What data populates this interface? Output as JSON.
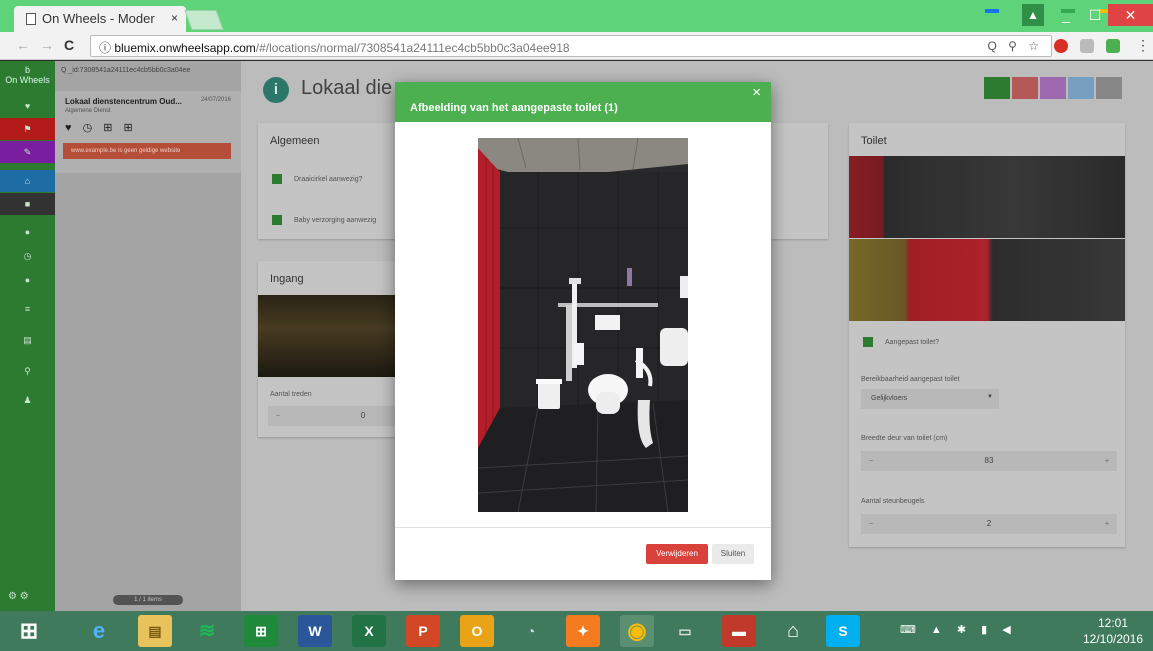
{
  "browser": {
    "tab_title": "On Wheels - Moder",
    "tab_close": "×",
    "window_controls": {
      "minimize": "_",
      "maximize": "☐",
      "close": "✕",
      "user": "▲"
    },
    "nav": {
      "back": "←",
      "forward": "→",
      "reload": "C"
    },
    "url_host": "bluemix.onwheelsapp.com",
    "url_path": "/#/locations/normal/7308541a24111ec4cb5bb0c3a04ee918",
    "url_right_icons": "Q ⚲ ☆",
    "menu": "⋮"
  },
  "rail": {
    "logo": "On Wheels",
    "items": [
      "♥",
      "⚑",
      "✎",
      "⌂",
      "■",
      "●",
      "◷",
      "●",
      "≡",
      "▤",
      "⚲",
      "♟"
    ],
    "bottom": "⚙ ⚙"
  },
  "list": {
    "search": "Q _id:7308541a24111ec4cb5bb0c3a04ee",
    "location_name": "Lokaal dienstencentrum Oud...",
    "location_date": "24/07/2016",
    "location_sub": "Algemene Dienst",
    "location_icons": "♥ ◷ ⊞ ⊞",
    "warning": "www.example.be is geen geldige website",
    "count": "1 / 1 items"
  },
  "main": {
    "info_icon": "i",
    "title": "Lokaal die",
    "algemeen": {
      "title": "Algemeen",
      "draaicirkel": "Draaicirkel aanwezig?",
      "baby": "Baby verzorging aanwezig"
    },
    "ingang": {
      "title": "Ingang",
      "treden_label": "Aantal treden",
      "treden_value": "0",
      "minus": "−"
    },
    "toilet": {
      "title": "Toilet",
      "aangepast": "Aangepast toilet?",
      "bereik_label": "Bereikbaarheid aangepast toilet",
      "bereik_value": "Gelijkvloers",
      "breedte_label": "Breedte deur van toilet (cm)",
      "breedte_value": "83",
      "steunbeugels_label": "Aantal steunbeugels",
      "steunbeugels_value": "2",
      "minus": "−",
      "plus": "+"
    },
    "action_colors": [
      "#2e7d32",
      "#b71c1c",
      "#7b1fa2",
      "#1e6fa8",
      "#555555"
    ]
  },
  "modal": {
    "title": "Afbeelding van het aangepaste toilet (1)",
    "close": "×",
    "delete_label": "Verwijderen",
    "close_label": "Sluiten"
  },
  "taskbar": {
    "apps": [
      "e",
      "▤",
      "≋",
      "⊞",
      "W",
      "X",
      "P",
      "O",
      "◔",
      "✦",
      "◉",
      "▭",
      "▬",
      "⌂",
      "S"
    ],
    "time": "12:01",
    "date": "12/10/2016"
  }
}
